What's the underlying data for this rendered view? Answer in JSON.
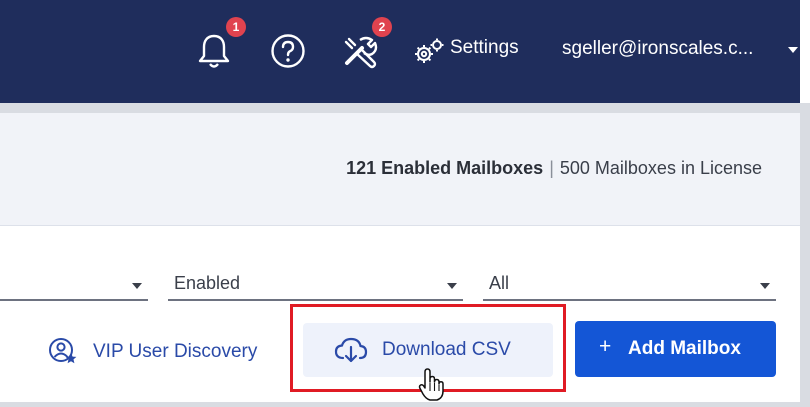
{
  "header": {
    "notifications": {
      "icon": "bell-icon",
      "badge": "1"
    },
    "help": {
      "icon": "help-circle-icon"
    },
    "tools": {
      "icon": "tools-icon",
      "badge": "2"
    },
    "settings": {
      "icon": "gears-icon",
      "label": "Settings"
    },
    "user": {
      "label": "sgeller@ironscales.c..."
    }
  },
  "stats": {
    "enabled": "121 Enabled Mailboxes",
    "separator": "|",
    "license": "500 Mailboxes in License"
  },
  "filters": [
    {
      "value": ""
    },
    {
      "value": "Enabled"
    },
    {
      "value": "All"
    }
  ],
  "actions": {
    "vip_label": "VIP User Discovery",
    "download_label": "Download CSV",
    "add_plus": "+",
    "add_label": "Add Mailbox"
  },
  "colors": {
    "header_bg": "#1f2d5c",
    "badge": "#e0434f",
    "link": "#2a4aa8",
    "primary": "#1456d6",
    "highlight": "#e01b24"
  }
}
